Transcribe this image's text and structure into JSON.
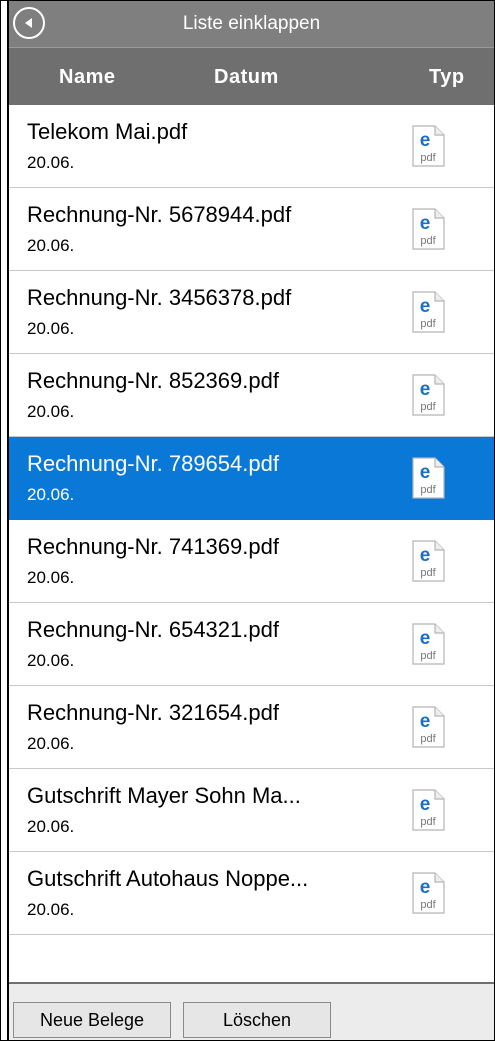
{
  "collapse_bar": {
    "label": "Liste einklappen"
  },
  "columns": {
    "name": "Name",
    "date": "Datum",
    "type": "Typ"
  },
  "documents": [
    {
      "name": "Telekom Mai.pdf",
      "date": "20.06.",
      "icon": "pdf-icon",
      "icon_label": "pdf"
    },
    {
      "name": "Rechnung-Nr. 5678944.pdf",
      "date": "20.06.",
      "icon": "pdf-icon",
      "icon_label": "pdf"
    },
    {
      "name": "Rechnung-Nr. 3456378.pdf",
      "date": "20.06.",
      "icon": "pdf-icon",
      "icon_label": "pdf"
    },
    {
      "name": "Rechnung-Nr. 852369.pdf",
      "date": "20.06.",
      "icon": "pdf-icon",
      "icon_label": "pdf"
    },
    {
      "name": "Rechnung-Nr. 789654.pdf",
      "date": "20.06.",
      "icon": "pdf-icon",
      "icon_label": "pdf",
      "selected": true
    },
    {
      "name": "Rechnung-Nr. 741369.pdf",
      "date": "20.06.",
      "icon": "pdf-icon",
      "icon_label": "pdf"
    },
    {
      "name": "Rechnung-Nr. 654321.pdf",
      "date": "20.06.",
      "icon": "pdf-icon",
      "icon_label": "pdf"
    },
    {
      "name": "Rechnung-Nr. 321654.pdf",
      "date": "20.06.",
      "icon": "pdf-icon",
      "icon_label": "pdf"
    },
    {
      "name": "Gutschrift Mayer  Sohn Ma...",
      "date": "20.06.",
      "icon": "pdf-icon",
      "icon_label": "pdf"
    },
    {
      "name": "Gutschrift Autohaus Noppe...",
      "date": "20.06.",
      "icon": "pdf-icon",
      "icon_label": "pdf"
    }
  ],
  "footer": {
    "new_label": "Neue Belege",
    "delete_label": "Löschen"
  },
  "colors": {
    "selection": "#0a78d7",
    "header_bg": "#6f6f6f",
    "collapse_bg": "#7f7f7f",
    "pdf_icon_blue": "#1d6fc2"
  }
}
